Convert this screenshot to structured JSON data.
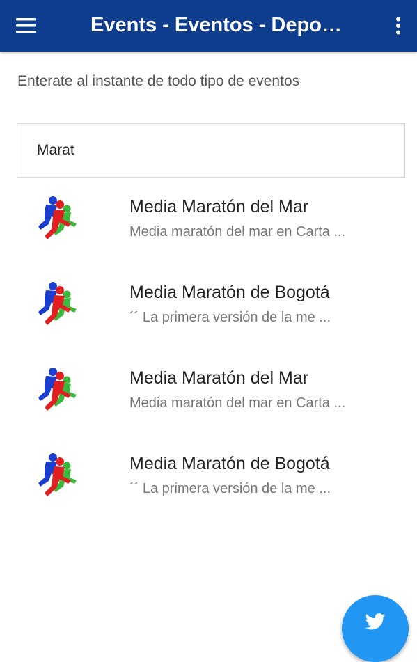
{
  "app_bar": {
    "title": "Events - Eventos - Depo…",
    "background": "#0d3d8c",
    "menu_icon": "hamburger-menu-icon",
    "overflow_icon": "more-vert-icon"
  },
  "subtitle": "Enterate al instante de todo tipo de eventos",
  "search": {
    "value": "Marat"
  },
  "events": [
    {
      "title": "Media Maratón del Mar",
      "description": "Media maratón del mar en Carta ...",
      "icon": "runners-logo-icon"
    },
    {
      "title": "Media Maratón de Bogotá",
      "description": "´´ La primera versión de la me ...",
      "icon": "runners-logo-icon"
    },
    {
      "title": "Media Maratón del Mar",
      "description": "Media maratón del mar en Carta ...",
      "icon": "runners-logo-icon"
    },
    {
      "title": "Media Maratón de Bogotá",
      "description": "´´ La primera versión de la me ...",
      "icon": "runners-logo-icon"
    }
  ],
  "fab": {
    "icon": "twitter-bird-icon",
    "color": "#2196f3"
  },
  "logo_colors": [
    "#1a3fd0",
    "#e02020",
    "#3cb83c"
  ]
}
